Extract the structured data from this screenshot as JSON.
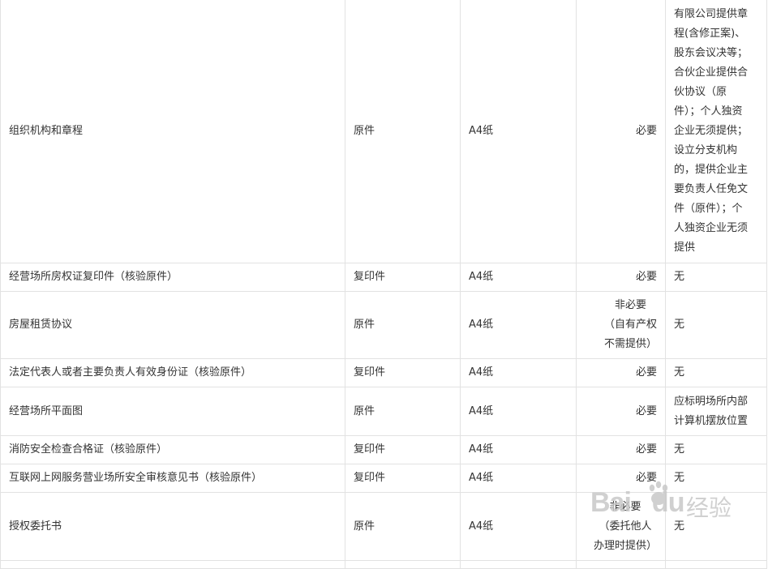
{
  "rows": [
    {
      "name": "组织机构和章程",
      "type": "原件",
      "paper": "A4纸",
      "required": "必要",
      "note": [
        "有限公司提供章",
        "程(含修正案)、",
        "股东会议决等；",
        "合伙企业提供合",
        "伙协议（原",
        "件）；个人独资",
        "企业无须提供；",
        "设立分支机构",
        "的，提供企业主",
        "要负责人任免文",
        "件（原件）；个",
        "人独资企业无须",
        "提供"
      ]
    },
    {
      "name": "经营场所房权证复印件（核验原件）",
      "type": "复印件",
      "paper": "A4纸",
      "required": "必要",
      "note": [
        "无"
      ]
    },
    {
      "name": "房屋租赁协议",
      "type": "原件",
      "paper": "A4纸",
      "required": "非必要\n（自有产权\n不需提供）",
      "note": [
        "无"
      ]
    },
    {
      "name": "法定代表人或者主要负责人有效身份证（核验原件）",
      "type": "复印件",
      "paper": "A4纸",
      "required": "必要",
      "note": [
        "无"
      ]
    },
    {
      "name": "经营场所平面图",
      "type": "原件",
      "paper": "A4纸",
      "required": "必要",
      "note": [
        "应标明场所内部",
        "计算机摆放位置"
      ]
    },
    {
      "name": "消防安全检查合格证（核验原件）",
      "type": "复印件",
      "paper": "A4纸",
      "required": "必要",
      "note": [
        "无"
      ]
    },
    {
      "name": "互联网上网服务营业场所安全审核意见书（核验原件）",
      "type": "复印件",
      "paper": "A4纸",
      "required": "必要",
      "note": [
        "无"
      ]
    },
    {
      "name": "授权委托书",
      "type": "原件",
      "paper": "A4纸",
      "required": "非必要\n（委托他人\n办理时提供）",
      "note": [
        "无"
      ]
    }
  ],
  "watermark": {
    "brand_latin": "Bai",
    "brand_latin_2": "du",
    "brand_cn": "经验",
    "icon": "baidu-paw-icon"
  }
}
